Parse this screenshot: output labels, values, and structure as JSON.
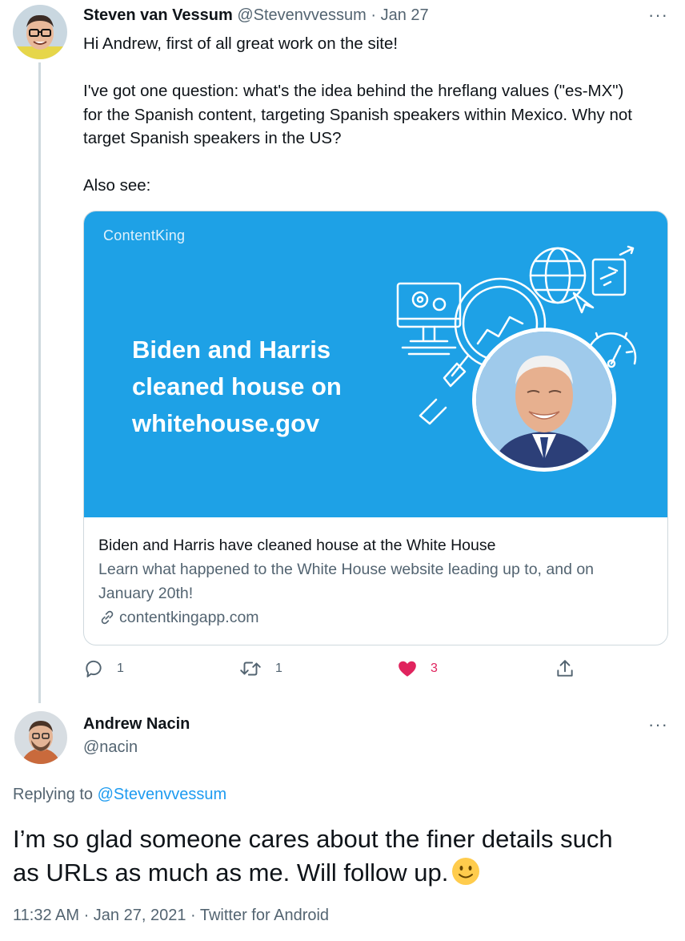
{
  "first_tweet": {
    "author_name": "Steven van Vessum",
    "author_handle": "@Stevenvvessum",
    "separator": "·",
    "date": "Jan 27",
    "more": "···",
    "text_lines": [
      "Hi Andrew, first of all great work on the site!",
      "",
      "I've got one question: what's the idea behind the hreflang values (\"es-MX\")",
      "for the Spanish content, targeting Spanish speakers within Mexico. Why not",
      "target Spanish speakers in the US?",
      "",
      "Also see:"
    ],
    "card": {
      "brand": "ContentKing",
      "headline_lines": [
        "Biden and Harris",
        "cleaned house on",
        "whitehouse.gov"
      ],
      "title": "Biden and Harris have cleaned house at the White House",
      "description_lines": [
        "Learn what happened to the White House website leading up to, and on",
        "January 20th!"
      ],
      "domain": "contentkingapp.com",
      "domain_icon": "link-icon",
      "background_color": "#1ea1e6"
    },
    "actions": {
      "reply_count": "1",
      "retweet_count": "1",
      "like_count": "3",
      "like_color": "#e0245e"
    }
  },
  "second_tweet": {
    "author_name": "Andrew Nacin",
    "author_handle": "@nacin",
    "more": "···",
    "replying_label": "Replying to",
    "replying_handle": "@Stevenvvessum",
    "text_line1": "I’m so glad someone cares about the finer details such",
    "text_line2": "as URLs as much as me. Will follow up.",
    "emoji": "slightly-smiling-face",
    "timestamp": "11:32 AM · Jan 27, 2021 · Twitter for Android"
  },
  "accent_color": "#1d9bf0"
}
